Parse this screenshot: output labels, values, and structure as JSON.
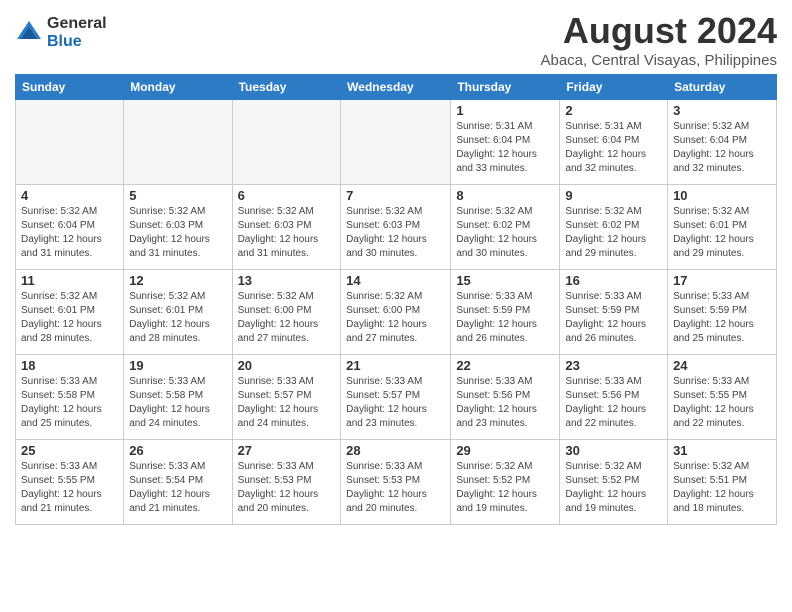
{
  "logo": {
    "general": "General",
    "blue": "Blue"
  },
  "title": "August 2024",
  "location": "Abaca, Central Visayas, Philippines",
  "days_of_week": [
    "Sunday",
    "Monday",
    "Tuesday",
    "Wednesday",
    "Thursday",
    "Friday",
    "Saturday"
  ],
  "weeks": [
    [
      {
        "day": "",
        "info": ""
      },
      {
        "day": "",
        "info": ""
      },
      {
        "day": "",
        "info": ""
      },
      {
        "day": "",
        "info": ""
      },
      {
        "day": "1",
        "info": "Sunrise: 5:31 AM\nSunset: 6:04 PM\nDaylight: 12 hours\nand 33 minutes."
      },
      {
        "day": "2",
        "info": "Sunrise: 5:31 AM\nSunset: 6:04 PM\nDaylight: 12 hours\nand 32 minutes."
      },
      {
        "day": "3",
        "info": "Sunrise: 5:32 AM\nSunset: 6:04 PM\nDaylight: 12 hours\nand 32 minutes."
      }
    ],
    [
      {
        "day": "4",
        "info": "Sunrise: 5:32 AM\nSunset: 6:04 PM\nDaylight: 12 hours\nand 31 minutes."
      },
      {
        "day": "5",
        "info": "Sunrise: 5:32 AM\nSunset: 6:03 PM\nDaylight: 12 hours\nand 31 minutes."
      },
      {
        "day": "6",
        "info": "Sunrise: 5:32 AM\nSunset: 6:03 PM\nDaylight: 12 hours\nand 31 minutes."
      },
      {
        "day": "7",
        "info": "Sunrise: 5:32 AM\nSunset: 6:03 PM\nDaylight: 12 hours\nand 30 minutes."
      },
      {
        "day": "8",
        "info": "Sunrise: 5:32 AM\nSunset: 6:02 PM\nDaylight: 12 hours\nand 30 minutes."
      },
      {
        "day": "9",
        "info": "Sunrise: 5:32 AM\nSunset: 6:02 PM\nDaylight: 12 hours\nand 29 minutes."
      },
      {
        "day": "10",
        "info": "Sunrise: 5:32 AM\nSunset: 6:01 PM\nDaylight: 12 hours\nand 29 minutes."
      }
    ],
    [
      {
        "day": "11",
        "info": "Sunrise: 5:32 AM\nSunset: 6:01 PM\nDaylight: 12 hours\nand 28 minutes."
      },
      {
        "day": "12",
        "info": "Sunrise: 5:32 AM\nSunset: 6:01 PM\nDaylight: 12 hours\nand 28 minutes."
      },
      {
        "day": "13",
        "info": "Sunrise: 5:32 AM\nSunset: 6:00 PM\nDaylight: 12 hours\nand 27 minutes."
      },
      {
        "day": "14",
        "info": "Sunrise: 5:32 AM\nSunset: 6:00 PM\nDaylight: 12 hours\nand 27 minutes."
      },
      {
        "day": "15",
        "info": "Sunrise: 5:33 AM\nSunset: 5:59 PM\nDaylight: 12 hours\nand 26 minutes."
      },
      {
        "day": "16",
        "info": "Sunrise: 5:33 AM\nSunset: 5:59 PM\nDaylight: 12 hours\nand 26 minutes."
      },
      {
        "day": "17",
        "info": "Sunrise: 5:33 AM\nSunset: 5:59 PM\nDaylight: 12 hours\nand 25 minutes."
      }
    ],
    [
      {
        "day": "18",
        "info": "Sunrise: 5:33 AM\nSunset: 5:58 PM\nDaylight: 12 hours\nand 25 minutes."
      },
      {
        "day": "19",
        "info": "Sunrise: 5:33 AM\nSunset: 5:58 PM\nDaylight: 12 hours\nand 24 minutes."
      },
      {
        "day": "20",
        "info": "Sunrise: 5:33 AM\nSunset: 5:57 PM\nDaylight: 12 hours\nand 24 minutes."
      },
      {
        "day": "21",
        "info": "Sunrise: 5:33 AM\nSunset: 5:57 PM\nDaylight: 12 hours\nand 23 minutes."
      },
      {
        "day": "22",
        "info": "Sunrise: 5:33 AM\nSunset: 5:56 PM\nDaylight: 12 hours\nand 23 minutes."
      },
      {
        "day": "23",
        "info": "Sunrise: 5:33 AM\nSunset: 5:56 PM\nDaylight: 12 hours\nand 22 minutes."
      },
      {
        "day": "24",
        "info": "Sunrise: 5:33 AM\nSunset: 5:55 PM\nDaylight: 12 hours\nand 22 minutes."
      }
    ],
    [
      {
        "day": "25",
        "info": "Sunrise: 5:33 AM\nSunset: 5:55 PM\nDaylight: 12 hours\nand 21 minutes."
      },
      {
        "day": "26",
        "info": "Sunrise: 5:33 AM\nSunset: 5:54 PM\nDaylight: 12 hours\nand 21 minutes."
      },
      {
        "day": "27",
        "info": "Sunrise: 5:33 AM\nSunset: 5:53 PM\nDaylight: 12 hours\nand 20 minutes."
      },
      {
        "day": "28",
        "info": "Sunrise: 5:33 AM\nSunset: 5:53 PM\nDaylight: 12 hours\nand 20 minutes."
      },
      {
        "day": "29",
        "info": "Sunrise: 5:32 AM\nSunset: 5:52 PM\nDaylight: 12 hours\nand 19 minutes."
      },
      {
        "day": "30",
        "info": "Sunrise: 5:32 AM\nSunset: 5:52 PM\nDaylight: 12 hours\nand 19 minutes."
      },
      {
        "day": "31",
        "info": "Sunrise: 5:32 AM\nSunset: 5:51 PM\nDaylight: 12 hours\nand 18 minutes."
      }
    ]
  ]
}
